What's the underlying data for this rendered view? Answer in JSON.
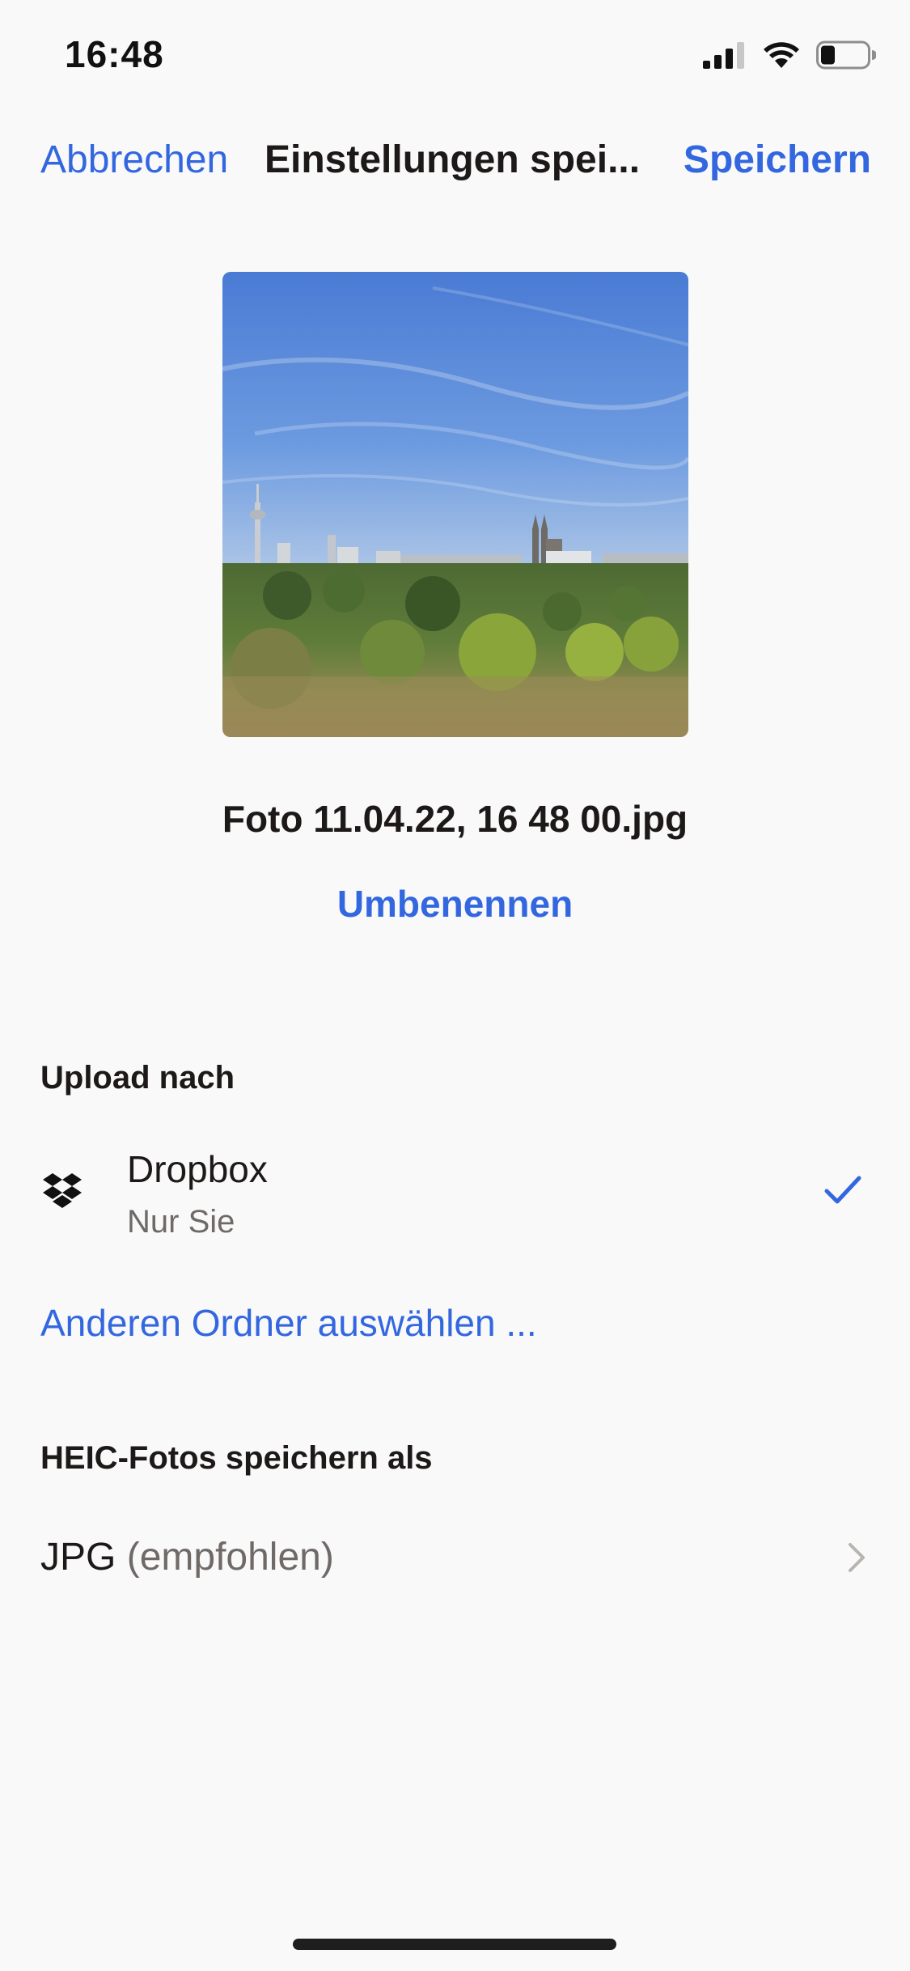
{
  "status_bar": {
    "time": "16:48"
  },
  "nav": {
    "cancel_label": "Abbrechen",
    "title": "Einstellungen spei...",
    "save_label": "Speichern"
  },
  "photo": {
    "icon": "photo-thumbnail"
  },
  "file": {
    "name": "Foto 11.04.22, 16 48 00.jpg",
    "rename_label": "Umbenennen"
  },
  "upload": {
    "heading": "Upload nach",
    "destination": {
      "title": "Dropbox",
      "subtitle": "Nur Sie",
      "selected": true
    },
    "other_folder_label": "Anderen Ordner auswählen ..."
  },
  "heic": {
    "heading": "HEIC-Fotos speichern als",
    "value": "JPG",
    "hint": "(empfohlen)"
  },
  "colors": {
    "accent": "#3367e0",
    "text": "#1e1919",
    "secondary_text": "#6f6a67",
    "background": "#f9f9f9"
  }
}
